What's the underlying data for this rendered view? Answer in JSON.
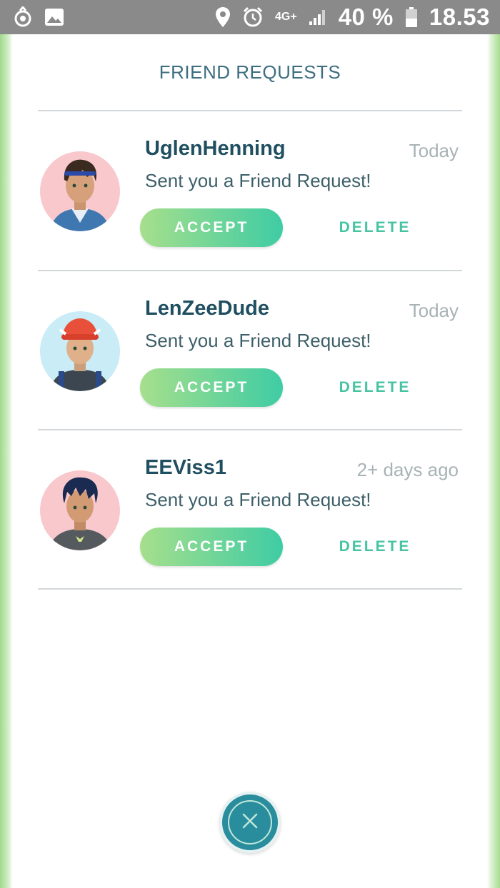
{
  "status_bar": {
    "network": "4G+",
    "battery": "40 %",
    "time": "18.53"
  },
  "title": "FRIEND REQUESTS",
  "requests": [
    {
      "name": "UglenHenning",
      "time": "Today",
      "message": "Sent you a Friend Request!",
      "accept_label": "ACCEPT",
      "delete_label": "DELETE",
      "avatar_bg": "#f8c8cc"
    },
    {
      "name": "LenZeeDude",
      "time": "Today",
      "message": "Sent you a Friend Request!",
      "accept_label": "ACCEPT",
      "delete_label": "DELETE",
      "avatar_bg": "#c9ecf6"
    },
    {
      "name": "EEViss1",
      "time": "2+ days ago",
      "message": "Sent you a Friend Request!",
      "accept_label": "ACCEPT",
      "delete_label": "DELETE",
      "avatar_bg": "#f8c8cc"
    }
  ],
  "icons": {
    "close": "close-icon",
    "status": [
      "app-notification-icon",
      "image-icon",
      "location-icon",
      "alarm-icon",
      "signal-icon",
      "battery-icon"
    ]
  },
  "colors": {
    "accent": "#46c4a2",
    "title": "#3d6e7f",
    "name": "#1f4f60",
    "close_button": "#2a8d9e"
  }
}
